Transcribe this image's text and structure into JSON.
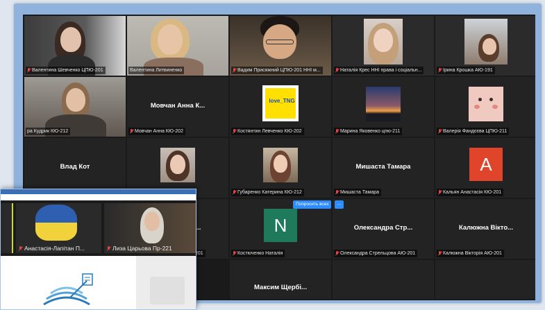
{
  "participants": [
    {
      "id": "p1",
      "name": "Валентина Шевченко ЦПЮ-201",
      "muted": true
    },
    {
      "id": "p2",
      "name": "Валентина Литвиненко",
      "muted": false,
      "speaking": true
    },
    {
      "id": "p3",
      "name": "Вадим Присяжний ЦПЮ-201 ННІ м...",
      "muted": true
    },
    {
      "id": "p4",
      "name": "Наталія Крес ННІ права і соціальн...",
      "muted": true
    },
    {
      "id": "p5",
      "name": "Ірина Крошка АЮ-191",
      "muted": true
    },
    {
      "id": "p6",
      "name": "ра Кудрик КЮ-212",
      "muted": false
    },
    {
      "id": "p7",
      "name": "Мовчан Анна КЮ-202",
      "display": "Мовчан Анна К...",
      "muted": true
    },
    {
      "id": "p8",
      "name": "Костянтин Левченко КЮ-202",
      "muted": true,
      "thumb_text": "love_TNG"
    },
    {
      "id": "p9",
      "name": "Марина Яковенко цпю-211",
      "muted": true
    },
    {
      "id": "p10",
      "name": "Валерія Фандєєва ЦПЮ-211",
      "muted": true
    },
    {
      "id": "p11",
      "display": "Влад Кот"
    },
    {
      "id": "p12",
      "name": "",
      "muted": false
    },
    {
      "id": "p13",
      "name": "Губаренко Катерина КЮ-212",
      "muted": true
    },
    {
      "id": "p14",
      "name": "Мишаста Тамара",
      "display": "Мишаста Тамара",
      "muted": true
    },
    {
      "id": "p15",
      "name": "Кальян Анастасія КЮ-201",
      "muted": true,
      "letter": "A",
      "color": "#e0442a"
    },
    {
      "id": "p16",
      "display": "рі...",
      "name": "201"
    },
    {
      "id": "p17",
      "name": "Костюченко Наталія",
      "muted": true,
      "letter": "N",
      "color": "#1f7a5c"
    },
    {
      "id": "p18",
      "name": "Олександра Стрельцова АЮ-201",
      "display": "Олександра Стр...",
      "muted": true
    },
    {
      "id": "p19",
      "name": "Калюжна Вікторія АЮ-201",
      "display": "Калюжна Вікто...",
      "muted": true
    },
    {
      "id": "p20",
      "display": "Максим Щербі..."
    }
  ],
  "controls": {
    "ask_all_label": "Попросить всех",
    "more_label": "..."
  },
  "overlay": {
    "tiles": [
      {
        "name": "Анастасія-Лапітан П...",
        "muted": true
      },
      {
        "name": "Лиза Царьова Пр-221",
        "muted": true
      }
    ]
  }
}
